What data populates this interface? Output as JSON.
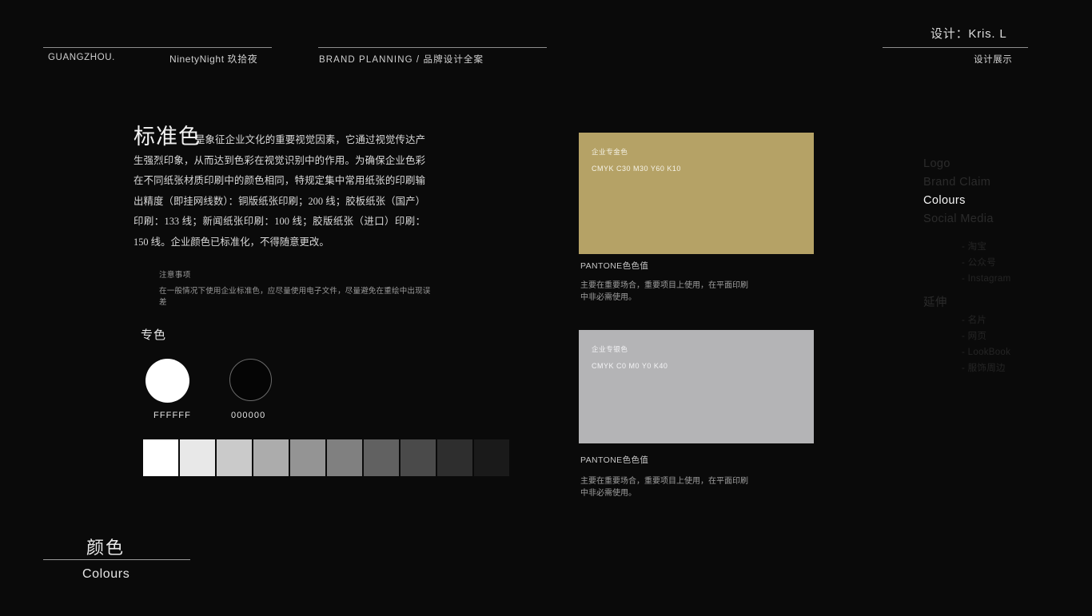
{
  "meta": {
    "background": "#0a0a0a"
  },
  "header": {
    "city": "GUANGZHOU.",
    "brand": "NinetyNight 玖拾夜",
    "project": "BRAND PLANNING / 品牌设计全案",
    "designer": "设计：Kris. L",
    "section_label": "设计展示"
  },
  "article": {
    "title": "标准色",
    "body": "是象征企业文化的重要视觉因素，它通过视觉传达产生强烈印象，从而达到色彩在视觉识别中的作用。为确保企业色彩在不同纸张材质印刷中的颜色相同，特规定集中常用纸张的印刷输出精度（即挂网线数）：铜版纸张印刷；200 线；胶板纸张（国产）印刷：133 线；新闻纸张印刷：100 线；胶版纸张（进口）印刷：150 线。企业颜色已标准化，不得随意更改。",
    "note_title": "注意事项",
    "note_body": "在一般情况下使用企业标准色，应尽量使用电子文件，尽量避免在重绘中出现误差"
  },
  "spot": {
    "label": "专色",
    "swatches": [
      {
        "name": "white-circle",
        "hex": "FFFFFF",
        "caption": "FFFFFF"
      },
      {
        "name": "black-circle",
        "hex": "000000",
        "caption": "000000"
      }
    ]
  },
  "ramp": {
    "values": [
      "#ffffff",
      "#e8e8e8",
      "#cacaca",
      "#acacac",
      "#949494",
      "#808080",
      "#616161",
      "#4a4a4a",
      "#2e2e2e",
      "#1a1a1a"
    ]
  },
  "panels": [
    {
      "name": "企业专金色",
      "cmyk": "CMYK C30 M30 Y60 K10",
      "hex": "#b5a266",
      "pantone_label": "PANTONE色色值",
      "description": "主要在重要场合，重要项目上使用，在平面印刷中非必需使用。"
    },
    {
      "name": "企业专银色",
      "cmyk": "CMYK C0 M0 Y0 K40",
      "hex": "#b4b4b6",
      "pantone_label": "PANTONE色色值",
      "description": "主要在重要场合，重要项目上使用，在平面印刷中非必需使用。"
    }
  ],
  "nav": {
    "items": [
      {
        "label": "Logo",
        "active": false
      },
      {
        "label": "Brand Claim",
        "active": false
      },
      {
        "label": "Colours",
        "active": true
      },
      {
        "label": "Social Media",
        "active": false
      }
    ],
    "social_sub": [
      "- 淘宝",
      "- 公众号",
      "- Instagram"
    ],
    "extend_label": "延伸",
    "extend_sub": [
      "- 名片",
      "- 网页",
      "- LookBook",
      "- 服饰周边"
    ]
  },
  "footer": {
    "title_cn": "颜色",
    "title_en": "Colours"
  }
}
